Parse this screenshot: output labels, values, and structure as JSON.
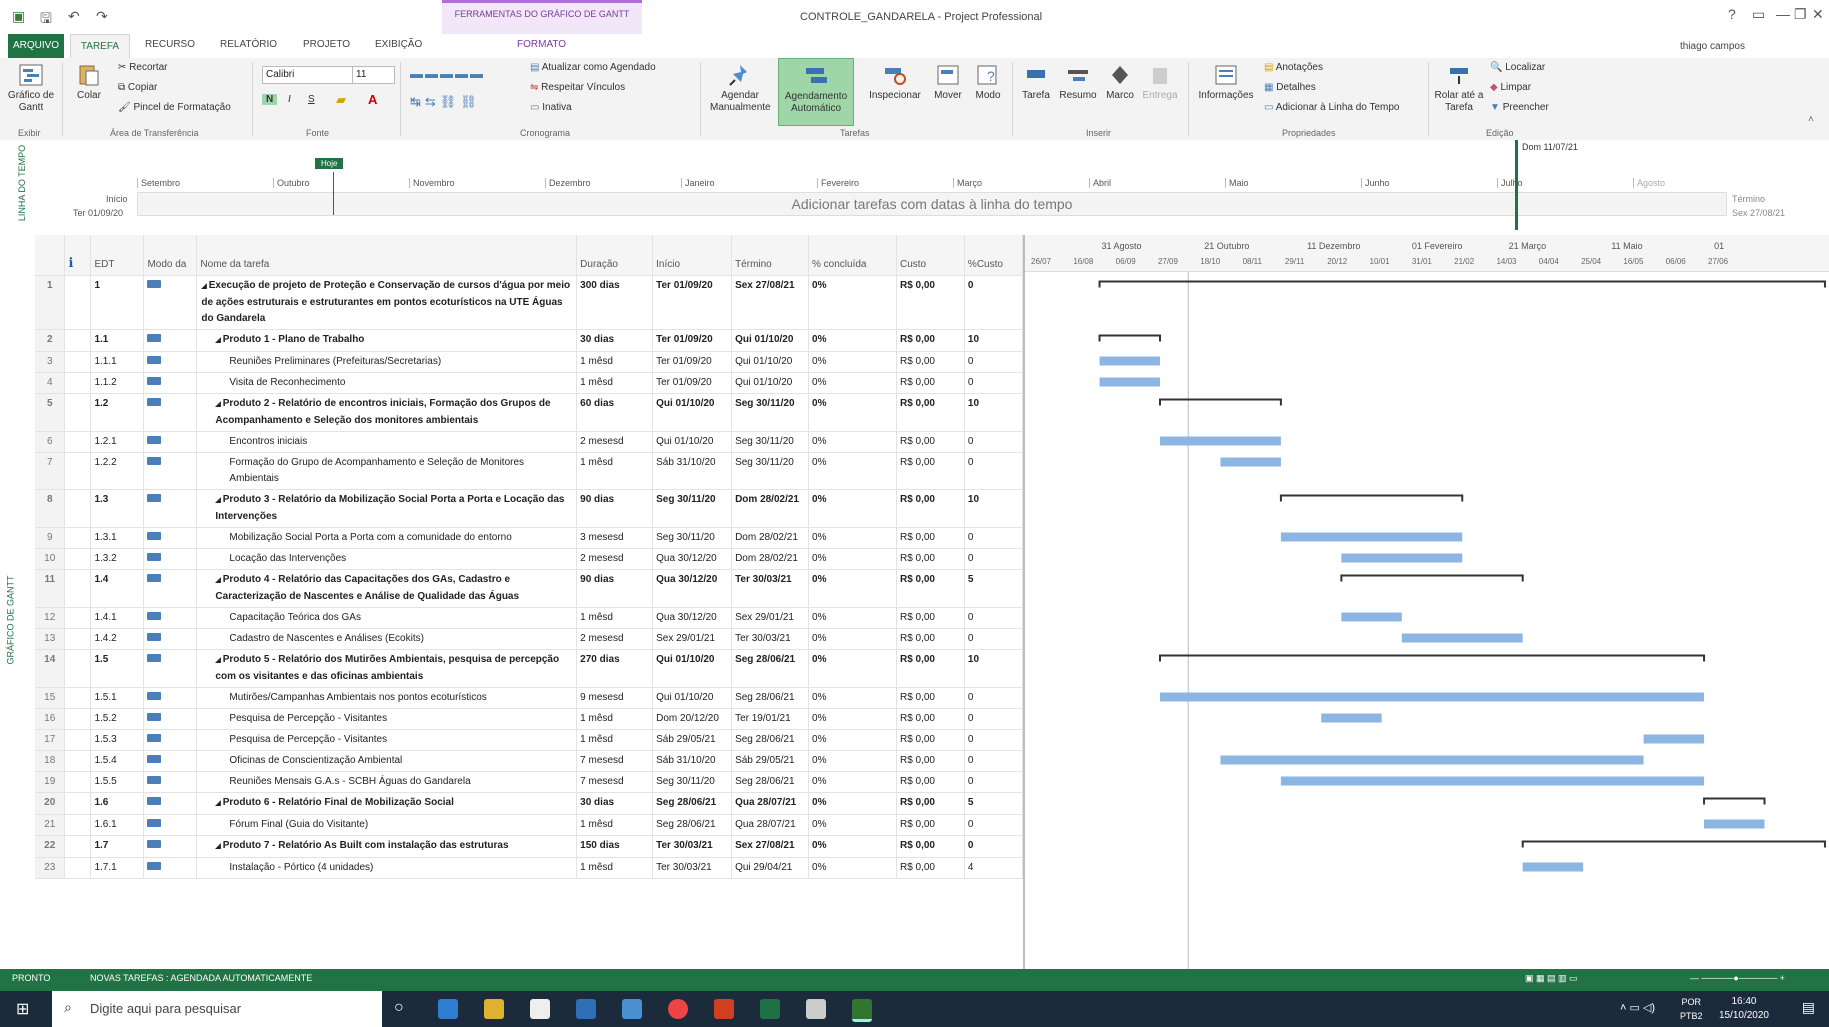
{
  "titlebar": {
    "window_title": "CONTROLE_GANDARELA - Project Professional",
    "context_tab_group": "FERRAMENTAS DO GRÁFICO DE GANTT",
    "context_tab": "FORMATO",
    "help": "?",
    "min": "—",
    "restore": "❐",
    "close": "✕"
  },
  "tabs": {
    "file": "ARQUIVO",
    "task": "TAREFA",
    "resource": "RECURSO",
    "report": "RELATÓRIO",
    "project": "PROJETO",
    "view": "EXIBIÇÃO",
    "user": "thiago campos"
  },
  "ribbon": {
    "gantt_chart": "Gráfico de Gantt",
    "paste": "Colar",
    "cut": "Recortar",
    "copy": "Copiar",
    "format_painter": "Pincel de Formatação",
    "font_name": "Calibri",
    "font_size": "11",
    "bold": "N",
    "italic": "I",
    "underline": "S",
    "update_as_scheduled": "Atualizar como Agendado",
    "respect_links": "Respeitar Vínculos",
    "inactivate": "Inativa",
    "manual_schedule": "Agendar Manualmente",
    "auto_schedule": "Agendamento Automático",
    "inspect": "Inspecionar",
    "move": "Mover",
    "mode": "Modo",
    "task": "Tarefa",
    "summary": "Resumo",
    "milestone": "Marco",
    "deliverable": "Entrega",
    "information": "Informações",
    "notes": "Anotações",
    "details": "Detalhes",
    "add_to_timeline": "Adicionar à Linha do Tempo",
    "scroll_to_task": "Rolar até a Tarefa",
    "find": "Localizar",
    "clear": "Limpar",
    "fill": "Preencher",
    "groups": {
      "view": "Exibir",
      "clipboard": "Área de Transferência",
      "font": "Fonte",
      "schedule": "Cronograma",
      "tasks": "Tarefas",
      "insert": "Inserir",
      "properties": "Propriedades",
      "editing": "Edição"
    }
  },
  "timeline": {
    "side_label": "LINHA DO TEMPO",
    "start_label": "Início",
    "start_date": "Ter 01/09/20",
    "today_label": "Hoje",
    "today_date": "Dom 11/07/21",
    "end_label": "Término",
    "end_date": "Sex 27/08/21",
    "placeholder": "Adicionar tarefas com datas à linha do tempo",
    "months": [
      "Setembro",
      "Outubro",
      "Novembro",
      "Dezembro",
      "Janeiro",
      "Fevereiro",
      "Março",
      "Abril",
      "Maio",
      "Junho",
      "Julho",
      "Agosto"
    ]
  },
  "grid": {
    "side_label": "GRÁFICO DE GANTT",
    "headers": {
      "info": "ℹ",
      "edt": "EDT",
      "mode": "Modo da",
      "name": "Nome da tarefa",
      "duration": "Duração",
      "start": "Início",
      "finish": "Término",
      "pct": "% concluída",
      "cost": "Custo",
      "pct_cost": "%Custo"
    },
    "rows": [
      {
        "n": "1",
        "edt": "1",
        "name": "Execução de projeto de Proteção e Conservação de cursos d'água por meio de ações estruturais e estruturantes em pontos ecoturísticos na UTE Águas do Gandarela",
        "dur": "300 dias",
        "start": "Ter 01/09/20",
        "finish": "Sex 27/08/21",
        "pct": "0%",
        "cost": "R$ 0,00",
        "pc": "0",
        "sum": true,
        "indent": 0
      },
      {
        "n": "2",
        "edt": "1.1",
        "name": "Produto 1 - Plano de Trabalho",
        "dur": "30 dias",
        "start": "Ter 01/09/20",
        "finish": "Qui 01/10/20",
        "pct": "0%",
        "cost": "R$ 0,00",
        "pc": "10",
        "sum": true,
        "indent": 1
      },
      {
        "n": "3",
        "edt": "1.1.1",
        "name": "Reuniões Preliminares (Prefeituras/Secretarias)",
        "dur": "1 mêsd",
        "start": "Ter 01/09/20",
        "finish": "Qui 01/10/20",
        "pct": "0%",
        "cost": "R$ 0,00",
        "pc": "0",
        "sum": false,
        "indent": 2
      },
      {
        "n": "4",
        "edt": "1.1.2",
        "name": "Visita de Reconhecimento",
        "dur": "1 mêsd",
        "start": "Ter 01/09/20",
        "finish": "Qui 01/10/20",
        "pct": "0%",
        "cost": "R$ 0,00",
        "pc": "0",
        "sum": false,
        "indent": 2
      },
      {
        "n": "5",
        "edt": "1.2",
        "name": "Produto 2 - Relatório de encontros iniciais, Formação dos Grupos de Acompanhamento e Seleção dos monitores ambientais",
        "dur": "60 dias",
        "start": "Qui 01/10/20",
        "finish": "Seg 30/11/20",
        "pct": "0%",
        "cost": "R$ 0,00",
        "pc": "10",
        "sum": true,
        "indent": 1
      },
      {
        "n": "6",
        "edt": "1.2.1",
        "name": "Encontros iniciais",
        "dur": "2 mesesd",
        "start": "Qui 01/10/20",
        "finish": "Seg 30/11/20",
        "pct": "0%",
        "cost": "R$ 0,00",
        "pc": "0",
        "sum": false,
        "indent": 2
      },
      {
        "n": "7",
        "edt": "1.2.2",
        "name": "Formação do Grupo de Acompanhamento e Seleção de Monitores Ambientais",
        "dur": "1 mêsd",
        "start": "Sáb 31/10/20",
        "finish": "Seg 30/11/20",
        "pct": "0%",
        "cost": "R$ 0,00",
        "pc": "0",
        "sum": false,
        "indent": 2
      },
      {
        "n": "8",
        "edt": "1.3",
        "name": "Produto 3 - Relatório da Mobilização Social Porta a Porta e Locação das Intervenções",
        "dur": "90 dias",
        "start": "Seg 30/11/20",
        "finish": "Dom 28/02/21",
        "pct": "0%",
        "cost": "R$ 0,00",
        "pc": "10",
        "sum": true,
        "indent": 1
      },
      {
        "n": "9",
        "edt": "1.3.1",
        "name": "Mobilização Social Porta a Porta com a comunidade do entorno",
        "dur": "3 mesesd",
        "start": "Seg 30/11/20",
        "finish": "Dom 28/02/21",
        "pct": "0%",
        "cost": "R$ 0,00",
        "pc": "0",
        "sum": false,
        "indent": 2
      },
      {
        "n": "10",
        "edt": "1.3.2",
        "name": "Locação das Intervenções",
        "dur": "2 mesesd",
        "start": "Qua 30/12/20",
        "finish": "Dom 28/02/21",
        "pct": "0%",
        "cost": "R$ 0,00",
        "pc": "0",
        "sum": false,
        "indent": 2
      },
      {
        "n": "11",
        "edt": "1.4",
        "name": "Produto 4 - Relatório das Capacitações dos GAs, Cadastro e Caracterização de Nascentes e Análise de Qualidade das Águas",
        "dur": "90 dias",
        "start": "Qua 30/12/20",
        "finish": "Ter 30/03/21",
        "pct": "0%",
        "cost": "R$ 0,00",
        "pc": "5",
        "sum": true,
        "indent": 1
      },
      {
        "n": "12",
        "edt": "1.4.1",
        "name": "Capacitação Teórica dos GAs",
        "dur": "1 mêsd",
        "start": "Qua 30/12/20",
        "finish": "Sex 29/01/21",
        "pct": "0%",
        "cost": "R$ 0,00",
        "pc": "0",
        "sum": false,
        "indent": 2
      },
      {
        "n": "13",
        "edt": "1.4.2",
        "name": "Cadastro de Nascentes e Análises (Ecokits)",
        "dur": "2 mesesd",
        "start": "Sex 29/01/21",
        "finish": "Ter 30/03/21",
        "pct": "0%",
        "cost": "R$ 0,00",
        "pc": "0",
        "sum": false,
        "indent": 2
      },
      {
        "n": "14",
        "edt": "1.5",
        "name": "Produto 5 - Relatório dos Mutirões Ambientais, pesquisa de percepção com os visitantes e das oficinas ambientais",
        "dur": "270 dias",
        "start": "Qui 01/10/20",
        "finish": "Seg 28/06/21",
        "pct": "0%",
        "cost": "R$ 0,00",
        "pc": "10",
        "sum": true,
        "indent": 1
      },
      {
        "n": "15",
        "edt": "1.5.1",
        "name": "Mutirões/Campanhas Ambientais nos pontos ecoturísticos",
        "dur": "9 mesesd",
        "start": "Qui 01/10/20",
        "finish": "Seg 28/06/21",
        "pct": "0%",
        "cost": "R$ 0,00",
        "pc": "0",
        "sum": false,
        "indent": 2
      },
      {
        "n": "16",
        "edt": "1.5.2",
        "name": "Pesquisa de Percepção - Visitantes",
        "dur": "1 mêsd",
        "start": "Dom 20/12/20",
        "finish": "Ter 19/01/21",
        "pct": "0%",
        "cost": "R$ 0,00",
        "pc": "0",
        "sum": false,
        "indent": 2
      },
      {
        "n": "17",
        "edt": "1.5.3",
        "name": "Pesquisa de Percepção - Visitantes",
        "dur": "1 mêsd",
        "start": "Sáb 29/05/21",
        "finish": "Seg 28/06/21",
        "pct": "0%",
        "cost": "R$ 0,00",
        "pc": "0",
        "sum": false,
        "indent": 2
      },
      {
        "n": "18",
        "edt": "1.5.4",
        "name": "Oficinas de Conscientização Ambiental",
        "dur": "7 mesesd",
        "start": "Sáb 31/10/20",
        "finish": "Sáb 29/05/21",
        "pct": "0%",
        "cost": "R$ 0,00",
        "pc": "0",
        "sum": false,
        "indent": 2
      },
      {
        "n": "19",
        "edt": "1.5.5",
        "name": "Reuniões Mensais G.A.s - SCBH Águas do Gandarela",
        "dur": "7 mesesd",
        "start": "Seg 30/11/20",
        "finish": "Seg 28/06/21",
        "pct": "0%",
        "cost": "R$ 0,00",
        "pc": "0",
        "sum": false,
        "indent": 2
      },
      {
        "n": "20",
        "edt": "1.6",
        "name": "Produto 6 - Relatório Final de Mobilização Social",
        "dur": "30 dias",
        "start": "Seg 28/06/21",
        "finish": "Qua 28/07/21",
        "pct": "0%",
        "cost": "R$ 0,00",
        "pc": "5",
        "sum": true,
        "indent": 1
      },
      {
        "n": "21",
        "edt": "1.6.1",
        "name": "Fórum Final (Guia do Visitante)",
        "dur": "1 mêsd",
        "start": "Seg 28/06/21",
        "finish": "Qua 28/07/21",
        "pct": "0%",
        "cost": "R$ 0,00",
        "pc": "0",
        "sum": false,
        "indent": 2
      },
      {
        "n": "22",
        "edt": "1.7",
        "name": "Produto 7 - Relatório As Built com instalação das estruturas",
        "dur": "150 dias",
        "start": "Ter 30/03/21",
        "finish": "Sex 27/08/21",
        "pct": "0%",
        "cost": "R$ 0,00",
        "pc": "0",
        "sum": true,
        "indent": 1
      },
      {
        "n": "23",
        "edt": "1.7.1",
        "name": "Instalação - Pórtico (4 unidades)",
        "dur": "1 mêsd",
        "start": "Ter 30/03/21",
        "finish": "Qui 29/04/21",
        "pct": "0%",
        "cost": "R$ 0,00",
        "pc": "4",
        "sum": false,
        "indent": 2
      }
    ]
  },
  "chart": {
    "months": [
      "31 Agosto",
      "21 Outubro",
      "11 Dezembro",
      "01 Fevereiro",
      "21 Março",
      "11 Maio",
      "01"
    ],
    "weeks": [
      "26/07",
      "16/08",
      "06/09",
      "27/09",
      "18/10",
      "08/11",
      "29/11",
      "20/12",
      "10/01",
      "31/01",
      "21/02",
      "14/03",
      "04/04",
      "25/04",
      "16/05",
      "06/06",
      "27/06"
    ],
    "bar_color": "#8bb6e4"
  },
  "status": {
    "ready": "PRONTO",
    "new_tasks": "NOVAS TAREFAS : AGENDADA AUTOMATICAMENTE"
  },
  "taskbar": {
    "search_placeholder": "Digite aqui para pesquisar",
    "lang": "POR",
    "layout": "PTB2",
    "time": "16:40",
    "date": "15/10/2020"
  }
}
